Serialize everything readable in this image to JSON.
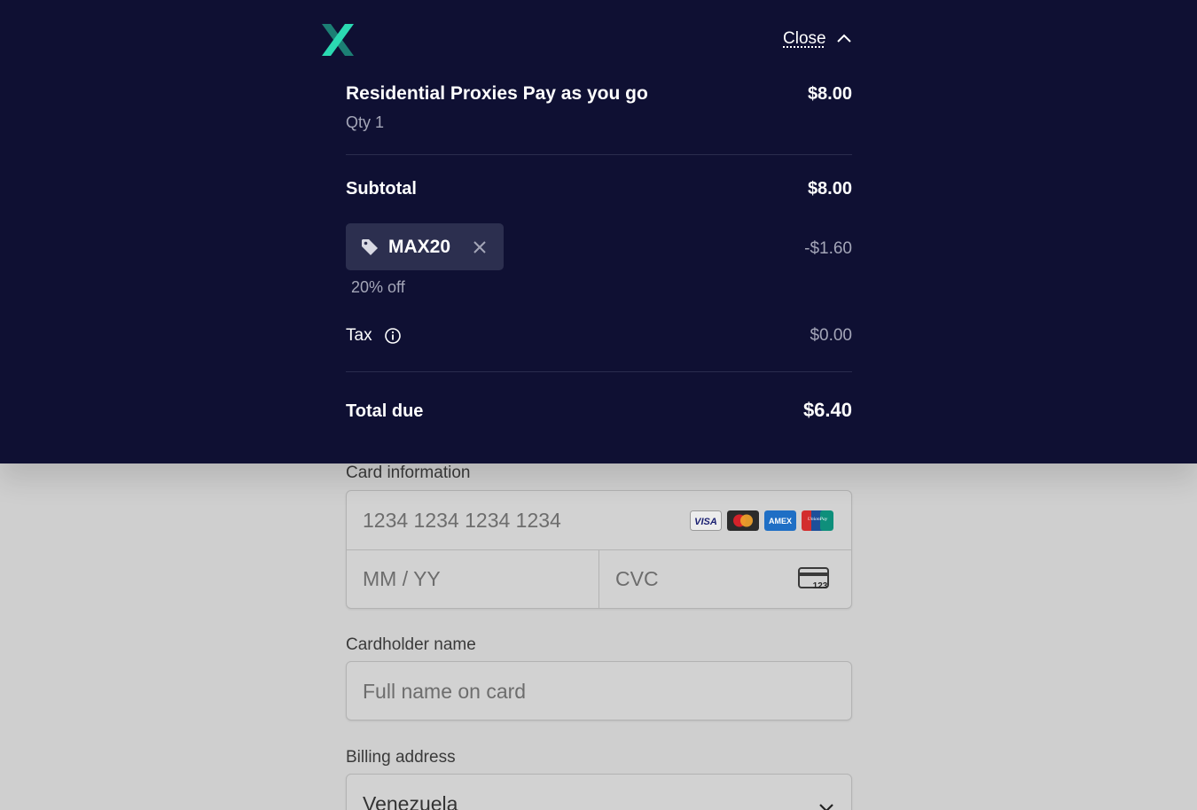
{
  "header": {
    "close_label": "Close"
  },
  "order": {
    "item_name": "Residential Proxies Pay as you go",
    "item_price": "$8.00",
    "qty_label": "Qty 1",
    "subtotal_label": "Subtotal",
    "subtotal_value": "$8.00",
    "promo_code": "MAX20",
    "discount_value": "-$1.60",
    "discount_desc": "20% off",
    "tax_label": "Tax",
    "tax_value": "$0.00",
    "total_label": "Total due",
    "total_value": "$6.40"
  },
  "payment": {
    "card_info_label": "Card information",
    "card_number_placeholder": "1234 1234 1234 1234",
    "expiry_placeholder": "MM / YY",
    "cvc_placeholder": "CVC",
    "cvc_icon_text": "123",
    "card_brands": [
      "VISA",
      "mastercard",
      "AMEX",
      "UnionPay"
    ],
    "cardholder_label": "Cardholder name",
    "cardholder_placeholder": "Full name on card",
    "billing_label": "Billing address",
    "country_value": "Venezuela"
  },
  "colors": {
    "panel_bg": "#0f1033",
    "logo_teal": "#2bd9b2",
    "logo_dark": "#1c7f74",
    "chip_bg": "#2c2f4f",
    "muted_text": "#a4a6b8",
    "page_overlay": "#cfcfcf"
  }
}
